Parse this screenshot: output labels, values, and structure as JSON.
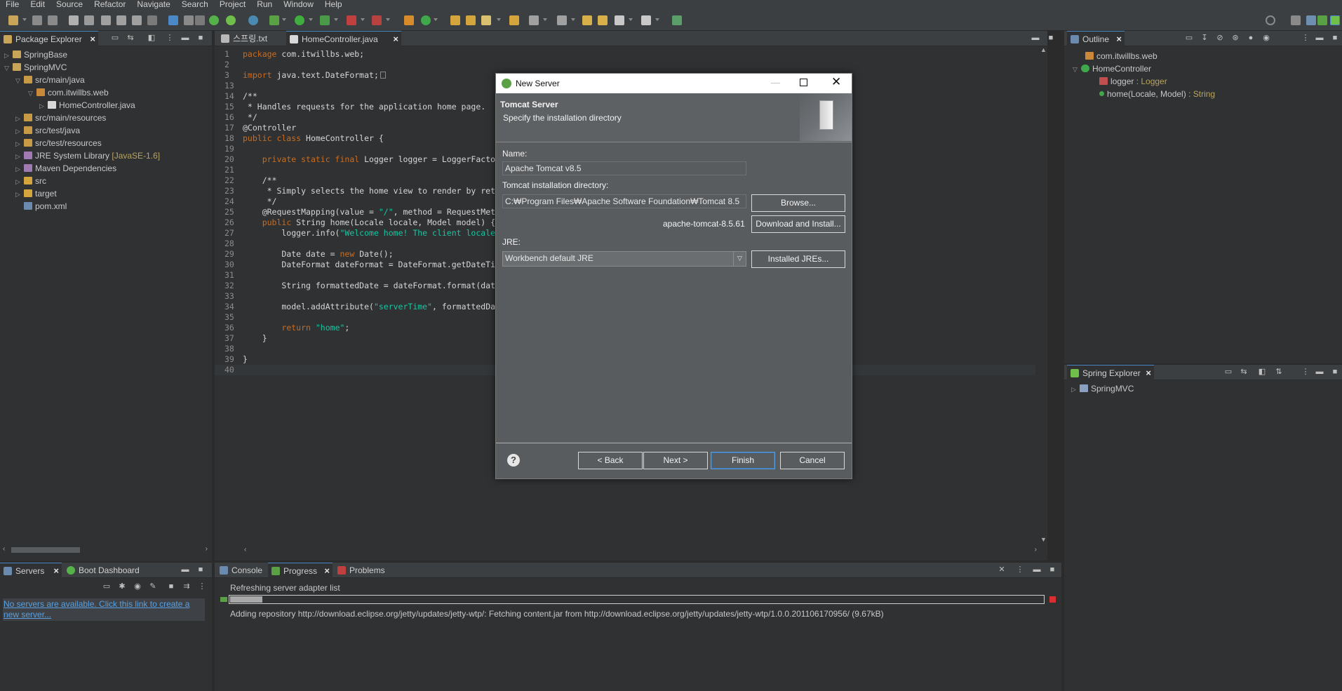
{
  "menu": [
    "File",
    "Edit",
    "Source",
    "Refactor",
    "Navigate",
    "Search",
    "Project",
    "Run",
    "Window",
    "Help"
  ],
  "package_explorer": {
    "tab": "Package Explorer",
    "items": [
      {
        "label": "SpringBase",
        "extra": ""
      },
      {
        "label": "SpringMVC",
        "extra": ""
      },
      {
        "label": "src/main/java",
        "extra": ""
      },
      {
        "label": "com.itwillbs.web",
        "extra": ""
      },
      {
        "label": "HomeController.java",
        "extra": ""
      },
      {
        "label": "src/main/resources",
        "extra": ""
      },
      {
        "label": "src/test/java",
        "extra": ""
      },
      {
        "label": "src/test/resources",
        "extra": ""
      },
      {
        "label": "JRE System Library",
        "extra": "[JavaSE-1.6]"
      },
      {
        "label": "Maven Dependencies",
        "extra": ""
      },
      {
        "label": "src",
        "extra": ""
      },
      {
        "label": "target",
        "extra": ""
      },
      {
        "label": "pom.xml",
        "extra": ""
      }
    ]
  },
  "editor": {
    "tabs": [
      "스프링.txt",
      "HomeController.java"
    ],
    "lines": [
      {
        "n": "1",
        "t": "package com.itwillbs.web;"
      },
      {
        "n": "2",
        "t": ""
      },
      {
        "n": "3",
        "t": "import java.text.DateFormat;"
      },
      {
        "n": "13",
        "t": ""
      },
      {
        "n": "14",
        "t": "/**"
      },
      {
        "n": "15",
        "t": " * Handles requests for the application home page."
      },
      {
        "n": "16",
        "t": " */"
      },
      {
        "n": "17",
        "t": "@Controller"
      },
      {
        "n": "18",
        "t": "public class HomeController {"
      },
      {
        "n": "19",
        "t": ""
      },
      {
        "n": "20",
        "t": "    private static final Logger logger = LoggerFacto"
      },
      {
        "n": "21",
        "t": ""
      },
      {
        "n": "22",
        "t": "    /**"
      },
      {
        "n": "23",
        "t": "     * Simply selects the home view to render by ret"
      },
      {
        "n": "24",
        "t": "     */"
      },
      {
        "n": "25",
        "t": "    @RequestMapping(value = \"/\", method = RequestMet"
      },
      {
        "n": "26",
        "t": "    public String home(Locale locale, Model model) {"
      },
      {
        "n": "27",
        "t": "        logger.info(\"Welcome home! The client locale"
      },
      {
        "n": "28",
        "t": ""
      },
      {
        "n": "29",
        "t": "        Date date = new Date();"
      },
      {
        "n": "30",
        "t": "        DateFormat dateFormat = DateFormat.getDateTi"
      },
      {
        "n": "31",
        "t": ""
      },
      {
        "n": "32",
        "t": "        String formattedDate = dateFormat.format(dat"
      },
      {
        "n": "33",
        "t": ""
      },
      {
        "n": "34",
        "t": "        model.addAttribute(\"serverTime\", formattedDa"
      },
      {
        "n": "35",
        "t": ""
      },
      {
        "n": "36",
        "t": "        return \"home\";"
      },
      {
        "n": "37",
        "t": "    }"
      },
      {
        "n": "38",
        "t": ""
      },
      {
        "n": "39",
        "t": "}"
      },
      {
        "n": "40",
        "t": ""
      }
    ]
  },
  "outline": {
    "tab": "Outline",
    "items": [
      {
        "label": "com.itwillbs.web",
        "type": ""
      },
      {
        "label": "HomeController",
        "type": ""
      },
      {
        "label": "logger",
        "type": " : Logger"
      },
      {
        "label": "home(Locale, Model)",
        "type": " : String"
      }
    ]
  },
  "spring_explorer": {
    "tab": "Spring Explorer",
    "items": [
      "SpringMVC"
    ]
  },
  "servers": {
    "tabs": [
      "Servers",
      "Boot Dashboard"
    ],
    "link": "No servers are available. Click this link to create a new server..."
  },
  "progress_panel": {
    "tabs": [
      "Console",
      "Progress",
      "Problems"
    ],
    "task": "Refreshing server adapter list",
    "progress_fraction": 0.04,
    "detail": "Adding repository http://download.eclipse.org/jetty/updates/jetty-wtp/: Fetching content.jar from http://download.eclipse.org/jetty/updates/jetty-wtp/1.0.0.201106170956/ (9.67kB)"
  },
  "dialog": {
    "title": "New Server",
    "header_title": "Tomcat Server",
    "header_subtitle": "Specify the installation directory",
    "name_label": "Name:",
    "name_value": "Apache Tomcat v8.5",
    "dir_label": "Tomcat installation directory:",
    "dir_value": "C:₩Program Files₩Apache Software Foundation₩Tomcat 8.5",
    "browse": "Browse...",
    "version_text": "apache-tomcat-8.5.61",
    "download": "Download and Install...",
    "jre_label": "JRE:",
    "jre_value": "Workbench default JRE",
    "installed_jres": "Installed JREs...",
    "help": "?",
    "back": "< Back",
    "next": "Next >",
    "finish": "Finish",
    "cancel": "Cancel"
  }
}
